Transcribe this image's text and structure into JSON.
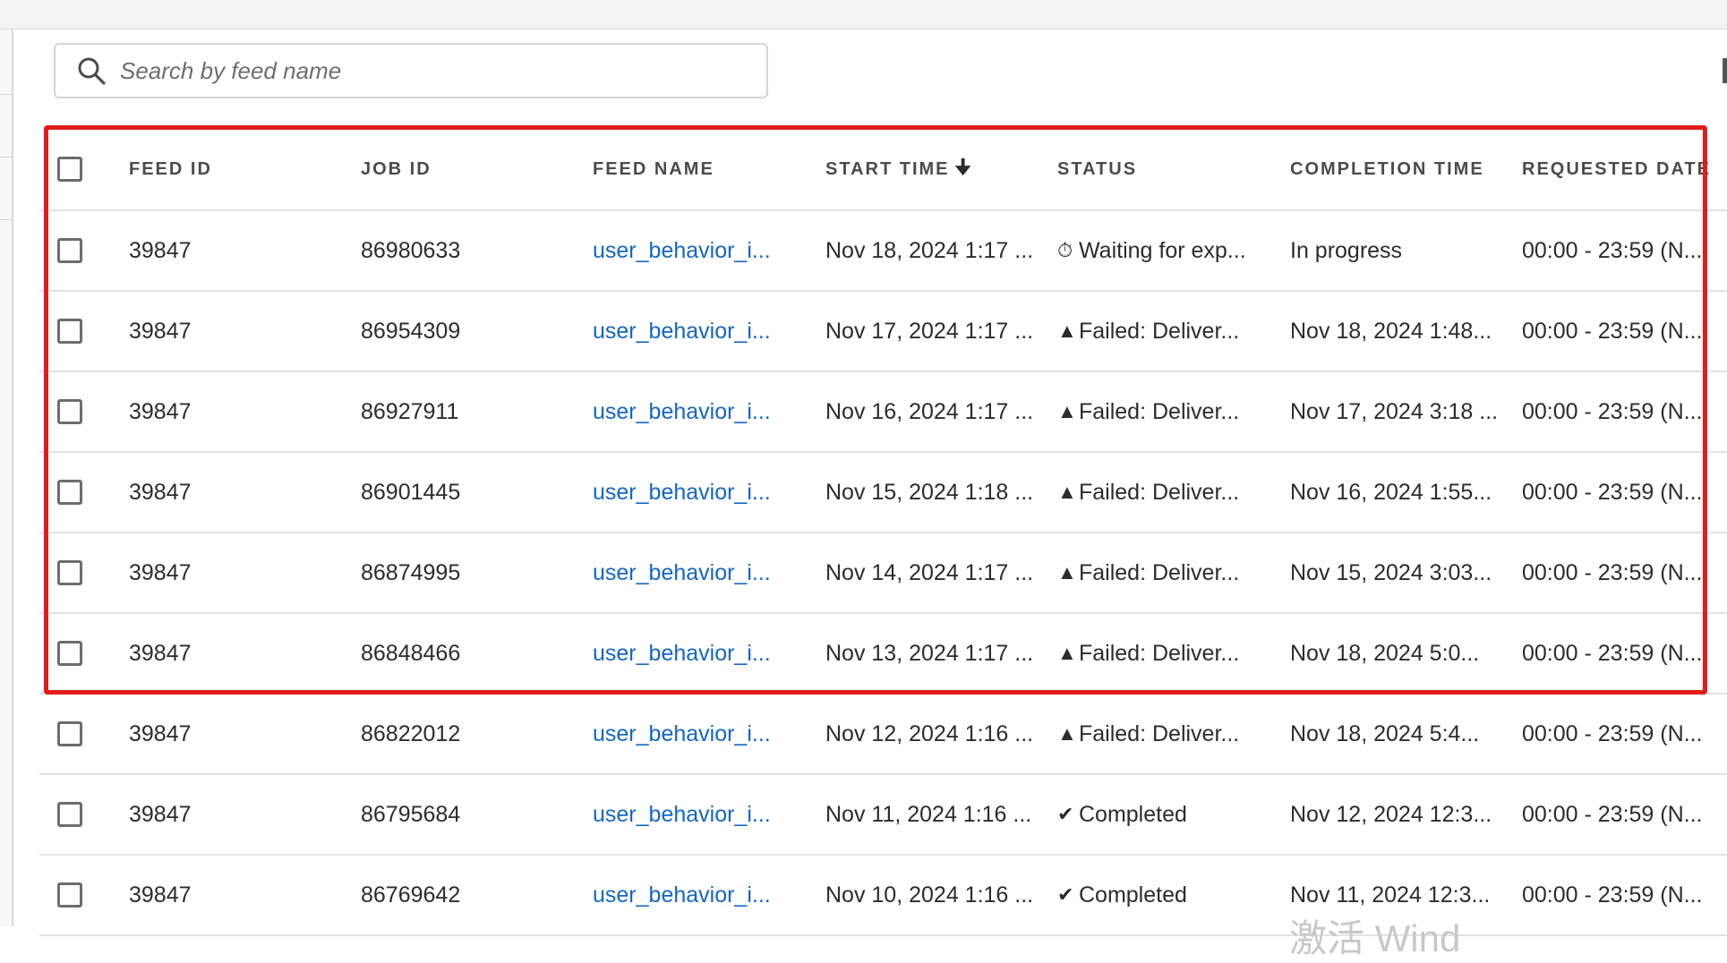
{
  "search": {
    "placeholder": "Search by feed name"
  },
  "table": {
    "columns": [
      {
        "key": "feed_id",
        "label": "FEED ID"
      },
      {
        "key": "job_id",
        "label": "JOB ID"
      },
      {
        "key": "feed_name",
        "label": "FEED NAME"
      },
      {
        "key": "start_time",
        "label": "START TIME",
        "sort": "descending"
      },
      {
        "key": "status",
        "label": "STATUS"
      },
      {
        "key": "completion_time",
        "label": "COMPLETION TIME"
      },
      {
        "key": "requested_date",
        "label": "REQUESTED DATE"
      }
    ],
    "rows": [
      {
        "feed_id": "39847",
        "job_id": "86980633",
        "feed_name": "user_behavior_i...",
        "start_time": "Nov 18, 2024 1:17 ...",
        "status_icon": "⏱",
        "status_icon_name": "stopwatch-icon",
        "status": "Waiting for exp...",
        "completion_time": "In progress",
        "requested_date": "00:00 - 23:59 (N..."
      },
      {
        "feed_id": "39847",
        "job_id": "86954309",
        "feed_name": "user_behavior_i...",
        "start_time": "Nov 17, 2024 1:17 ...",
        "status_icon": "▲",
        "status_icon_name": "alert-icon",
        "status": "Failed: Deliver...",
        "completion_time": "Nov 18, 2024 1:48...",
        "requested_date": "00:00 - 23:59 (N..."
      },
      {
        "feed_id": "39847",
        "job_id": "86927911",
        "feed_name": "user_behavior_i...",
        "start_time": "Nov 16, 2024 1:17 ...",
        "status_icon": "▲",
        "status_icon_name": "alert-icon",
        "status": "Failed: Deliver...",
        "completion_time": "Nov 17, 2024 3:18 ...",
        "requested_date": "00:00 - 23:59 (N..."
      },
      {
        "feed_id": "39847",
        "job_id": "86901445",
        "feed_name": "user_behavior_i...",
        "start_time": "Nov 15, 2024 1:18 ...",
        "status_icon": "▲",
        "status_icon_name": "alert-icon",
        "status": "Failed: Deliver...",
        "completion_time": "Nov 16, 2024 1:55...",
        "requested_date": "00:00 - 23:59 (N..."
      },
      {
        "feed_id": "39847",
        "job_id": "86874995",
        "feed_name": "user_behavior_i...",
        "start_time": "Nov 14, 2024 1:17 ...",
        "status_icon": "▲",
        "status_icon_name": "alert-icon",
        "status": "Failed: Deliver...",
        "completion_time": "Nov 15, 2024 3:03...",
        "requested_date": "00:00 - 23:59 (N..."
      },
      {
        "feed_id": "39847",
        "job_id": "86848466",
        "feed_name": "user_behavior_i...",
        "start_time": "Nov 13, 2024 1:17 ...",
        "status_icon": "▲",
        "status_icon_name": "alert-icon",
        "status": "Failed: Deliver...",
        "completion_time": "Nov 18, 2024 5:0...",
        "requested_date": "00:00 - 23:59 (N..."
      },
      {
        "feed_id": "39847",
        "job_id": "86822012",
        "feed_name": "user_behavior_i...",
        "start_time": "Nov 12, 2024 1:16 ...",
        "status_icon": "▲",
        "status_icon_name": "alert-icon",
        "status": "Failed: Deliver...",
        "completion_time": "Nov 18, 2024 5:4...",
        "requested_date": "00:00 - 23:59 (N..."
      },
      {
        "feed_id": "39847",
        "job_id": "86795684",
        "feed_name": "user_behavior_i...",
        "start_time": "Nov 11, 2024 1:16 ...",
        "status_icon": "✔",
        "status_icon_name": "checkmark-circle-icon",
        "status": "Completed",
        "completion_time": "Nov 12, 2024 12:3...",
        "requested_date": "00:00 - 23:59 (N..."
      },
      {
        "feed_id": "39847",
        "job_id": "86769642",
        "feed_name": "user_behavior_i...",
        "start_time": "Nov 10, 2024 1:16 ...",
        "status_icon": "✔",
        "status_icon_name": "checkmark-circle-icon",
        "status": "Completed",
        "completion_time": "Nov 11, 2024 12:3...",
        "requested_date": "00:00 - 23:59 (N..."
      }
    ]
  },
  "highlight": {
    "color": "#e31b1b"
  },
  "colors": {
    "link": "#1366c7",
    "text": "#2c2c2c"
  },
  "watermark": {
    "text": "激活 Wind"
  }
}
